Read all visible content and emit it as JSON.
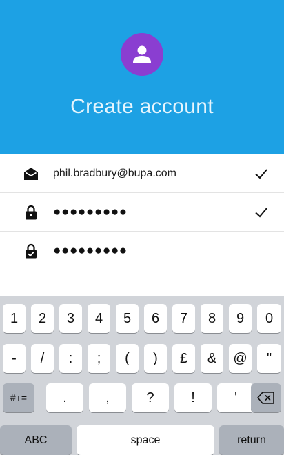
{
  "colors": {
    "header_bg": "#1da1e4",
    "avatar_bg": "#8a3ed1",
    "keyboard_bg": "#d1d4d9"
  },
  "header": {
    "icon": "user-icon",
    "title": "Create account"
  },
  "form": {
    "email": {
      "icon": "envelope-open-icon",
      "value": "phil.bradbury@bupa.com",
      "valid": true
    },
    "password": {
      "icon": "lock-icon",
      "value": "●●●●●●●●●",
      "valid": true
    },
    "confirm_password": {
      "icon": "lock-check-icon",
      "value": "●●●●●●●●●",
      "valid": false
    }
  },
  "keyboard": {
    "row1": [
      "1",
      "2",
      "3",
      "4",
      "5",
      "6",
      "7",
      "8",
      "9",
      "0"
    ],
    "row2": [
      "-",
      "/",
      ":",
      ";",
      "(",
      ")",
      "£",
      "&",
      "@",
      "\""
    ],
    "row3": {
      "shift": "#+=",
      "keys": [
        ".",
        ",",
        "?",
        "!",
        "'"
      ],
      "delete_icon": "backspace-icon"
    },
    "row4": {
      "mode": "ABC",
      "space": "space",
      "return": "return"
    }
  }
}
